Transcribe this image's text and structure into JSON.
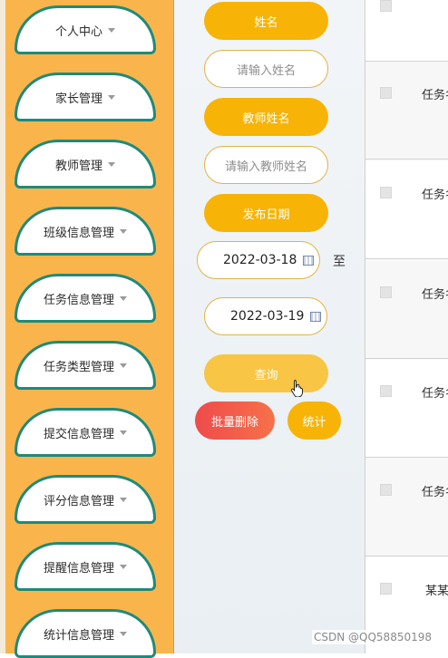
{
  "sidebar": {
    "items": [
      {
        "label": "个人中心"
      },
      {
        "label": "家长管理"
      },
      {
        "label": "教师管理"
      },
      {
        "label": "班级信息管理"
      },
      {
        "label": "任务信息管理"
      },
      {
        "label": "任务类型管理"
      },
      {
        "label": "提交信息管理"
      },
      {
        "label": "评分信息管理"
      },
      {
        "label": "提醒信息管理"
      },
      {
        "label": "统计信息管理"
      }
    ]
  },
  "filters": {
    "name_label": "姓名",
    "name_placeholder": "请输入姓名",
    "teacher_label": "教师姓名",
    "teacher_placeholder": "请输入教师姓名",
    "date_label": "发布日期",
    "date_start": "2022-03-18",
    "date_sep": "至",
    "date_end": "2022-03-19",
    "search_button": "查询",
    "batch_delete_button": "批量删除",
    "stats_button": "统计"
  },
  "table": {
    "rows": [
      {
        "text": "任务名"
      },
      {
        "text": "任务名"
      },
      {
        "text": "任务名"
      },
      {
        "text": "任务名"
      },
      {
        "text": "任务名"
      },
      {
        "text": "某某"
      }
    ]
  },
  "watermark": "CSDN @QQ58850198",
  "colors": {
    "sidebar_bg": "#f9b54b",
    "accent": "#f7b407",
    "nav_border": "#1f8a7a",
    "danger": "#f2594a"
  }
}
